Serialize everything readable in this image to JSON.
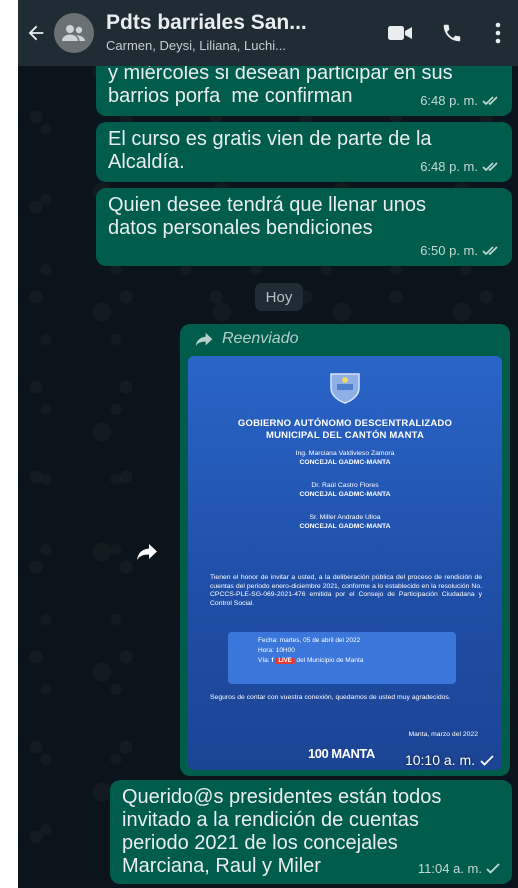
{
  "header": {
    "back_icon": "arrow-left-icon",
    "avatar_icon": "group-icon",
    "title": "Pdts barriales San...",
    "subtitle": "Carmen, Deysi, Liliana, Luchi...",
    "actions": [
      "video-call-icon",
      "phone-icon",
      "more-vertical-icon"
    ]
  },
  "messages": [
    {
      "text": "y miércoles si desean participar en sus\nbarrios porfa  me confirman",
      "time": "6:48 p. m.",
      "status": "read"
    },
    {
      "text": "El curso es gratis vien de parte de la\nAlcaldía.",
      "time": "6:48 p. m.",
      "status": "read"
    },
    {
      "text": "Quien desee tendrá que llenar unos\ndatos personales bendiciones",
      "time": "6:50 p. m.",
      "status": "read"
    }
  ],
  "day_separator": "Hoy",
  "forwarded_image": {
    "label": "Reenviado",
    "time": "10:10 a. m.",
    "status": "sent",
    "flyer": {
      "title": "GOBIERNO AUTÓNOMO DESCENTRALIZADO\nMUNICIPAL DEL CANTÓN MANTA",
      "persons": [
        {
          "name": "Ing. Marciana Valdivieso Zamora",
          "role": "CONCEJAL GADMC-MANTA"
        },
        {
          "name": "Dr. Raúl Castro Flores",
          "role": "CONCEJAL GADMC-MANTA"
        },
        {
          "name": "Sr. Miller Andrade Ulloa",
          "role": "CONCEJAL GADMC-MANTA"
        }
      ],
      "body": "Tienen el honor de invitar a usted, a la deliberación pública del proceso de rendición de cuentas del periodo enero-diciembre 2021, conforme a lo establecido en la resolución No. CPCCS-PLE-SG-069-2021-476 emitida por el Consejo de Participación Ciudadana y Control Social.",
      "fecha": "Fecha: martes, 05 de abril del 2022",
      "hora": "Hora: 10H00",
      "via_prefix": "Vía:",
      "live": "LIVE",
      "via_suffix": "del Municipio de Manta",
      "closing": "Seguros de contar con vuestra conexión, quedamos de usted muy agradecidos.",
      "place_date": "Manta, marzo del 2022",
      "brand": "100 MANTA"
    }
  },
  "last_message": {
    "text": "Querido@s presidentes están todos\ninvitado a la rendición de cuentas\nperiodo 2021 de los concejales\nMarciana, Raul y Miler",
    "time": "11:04 a. m.",
    "status": "sent"
  },
  "colors": {
    "outgoing_bubble": "#005c4b",
    "header": "#1f2c34",
    "background": "#0b141a"
  }
}
